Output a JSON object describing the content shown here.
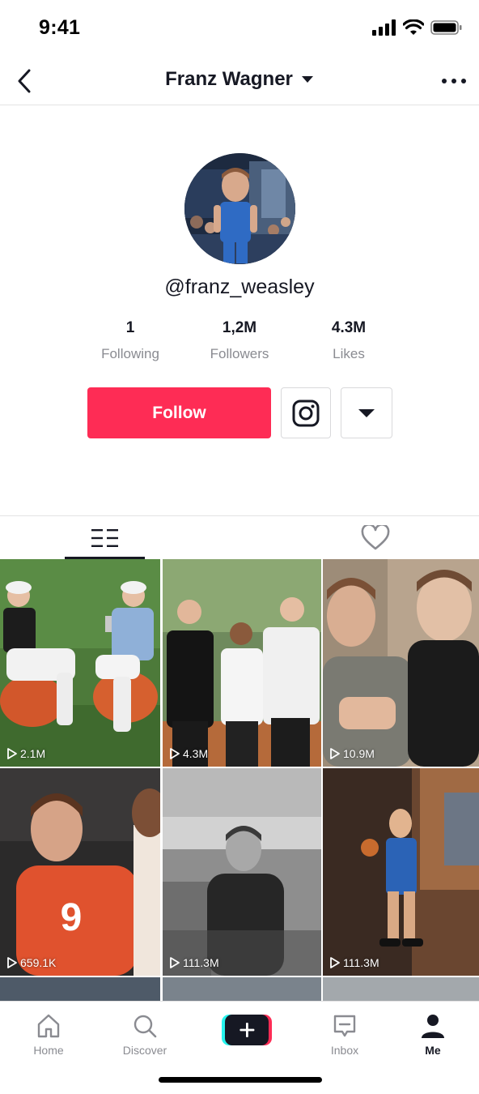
{
  "status_bar": {
    "time": "9:41",
    "icons": [
      "signal-icon",
      "wifi-icon",
      "battery-icon"
    ]
  },
  "header": {
    "title": "Franz Wagner",
    "back_icon": "chevron-left-icon",
    "dropdown_icon": "caret-down-icon",
    "more_icon": "ellipsis-icon"
  },
  "profile": {
    "handle": "@franz_weasley",
    "stats": [
      {
        "value": "1",
        "label": "Following"
      },
      {
        "value": "1,2M",
        "label": "Followers"
      },
      {
        "value": "4.3M",
        "label": "Likes"
      }
    ],
    "follow_label": "Follow",
    "instagram_icon": "instagram-icon",
    "more_icon": "caret-down-icon"
  },
  "tabs": [
    {
      "name": "videos",
      "icon": "grid-lines-icon",
      "active": true
    },
    {
      "name": "liked",
      "icon": "heart-outline-icon",
      "active": false
    }
  ],
  "videos": [
    {
      "views": "2.1M"
    },
    {
      "views": "4.3M"
    },
    {
      "views": "10.9M"
    },
    {
      "views": "659.1K"
    },
    {
      "views": "111.3M"
    },
    {
      "views": "111.3M"
    }
  ],
  "bottom_nav": [
    {
      "label": "Home",
      "icon": "home-icon",
      "active": false
    },
    {
      "label": "Discover",
      "icon": "search-icon",
      "active": false
    },
    {
      "label": "",
      "icon": "plus-icon",
      "active": false
    },
    {
      "label": "Inbox",
      "icon": "inbox-icon",
      "active": false
    },
    {
      "label": "Me",
      "icon": "person-icon",
      "active": true
    }
  ],
  "colors": {
    "accent": "#fe2c55",
    "text_primary": "#161823",
    "text_secondary": "#8a8b91",
    "create_left": "#25f4ee",
    "create_right": "#fe2c55"
  }
}
